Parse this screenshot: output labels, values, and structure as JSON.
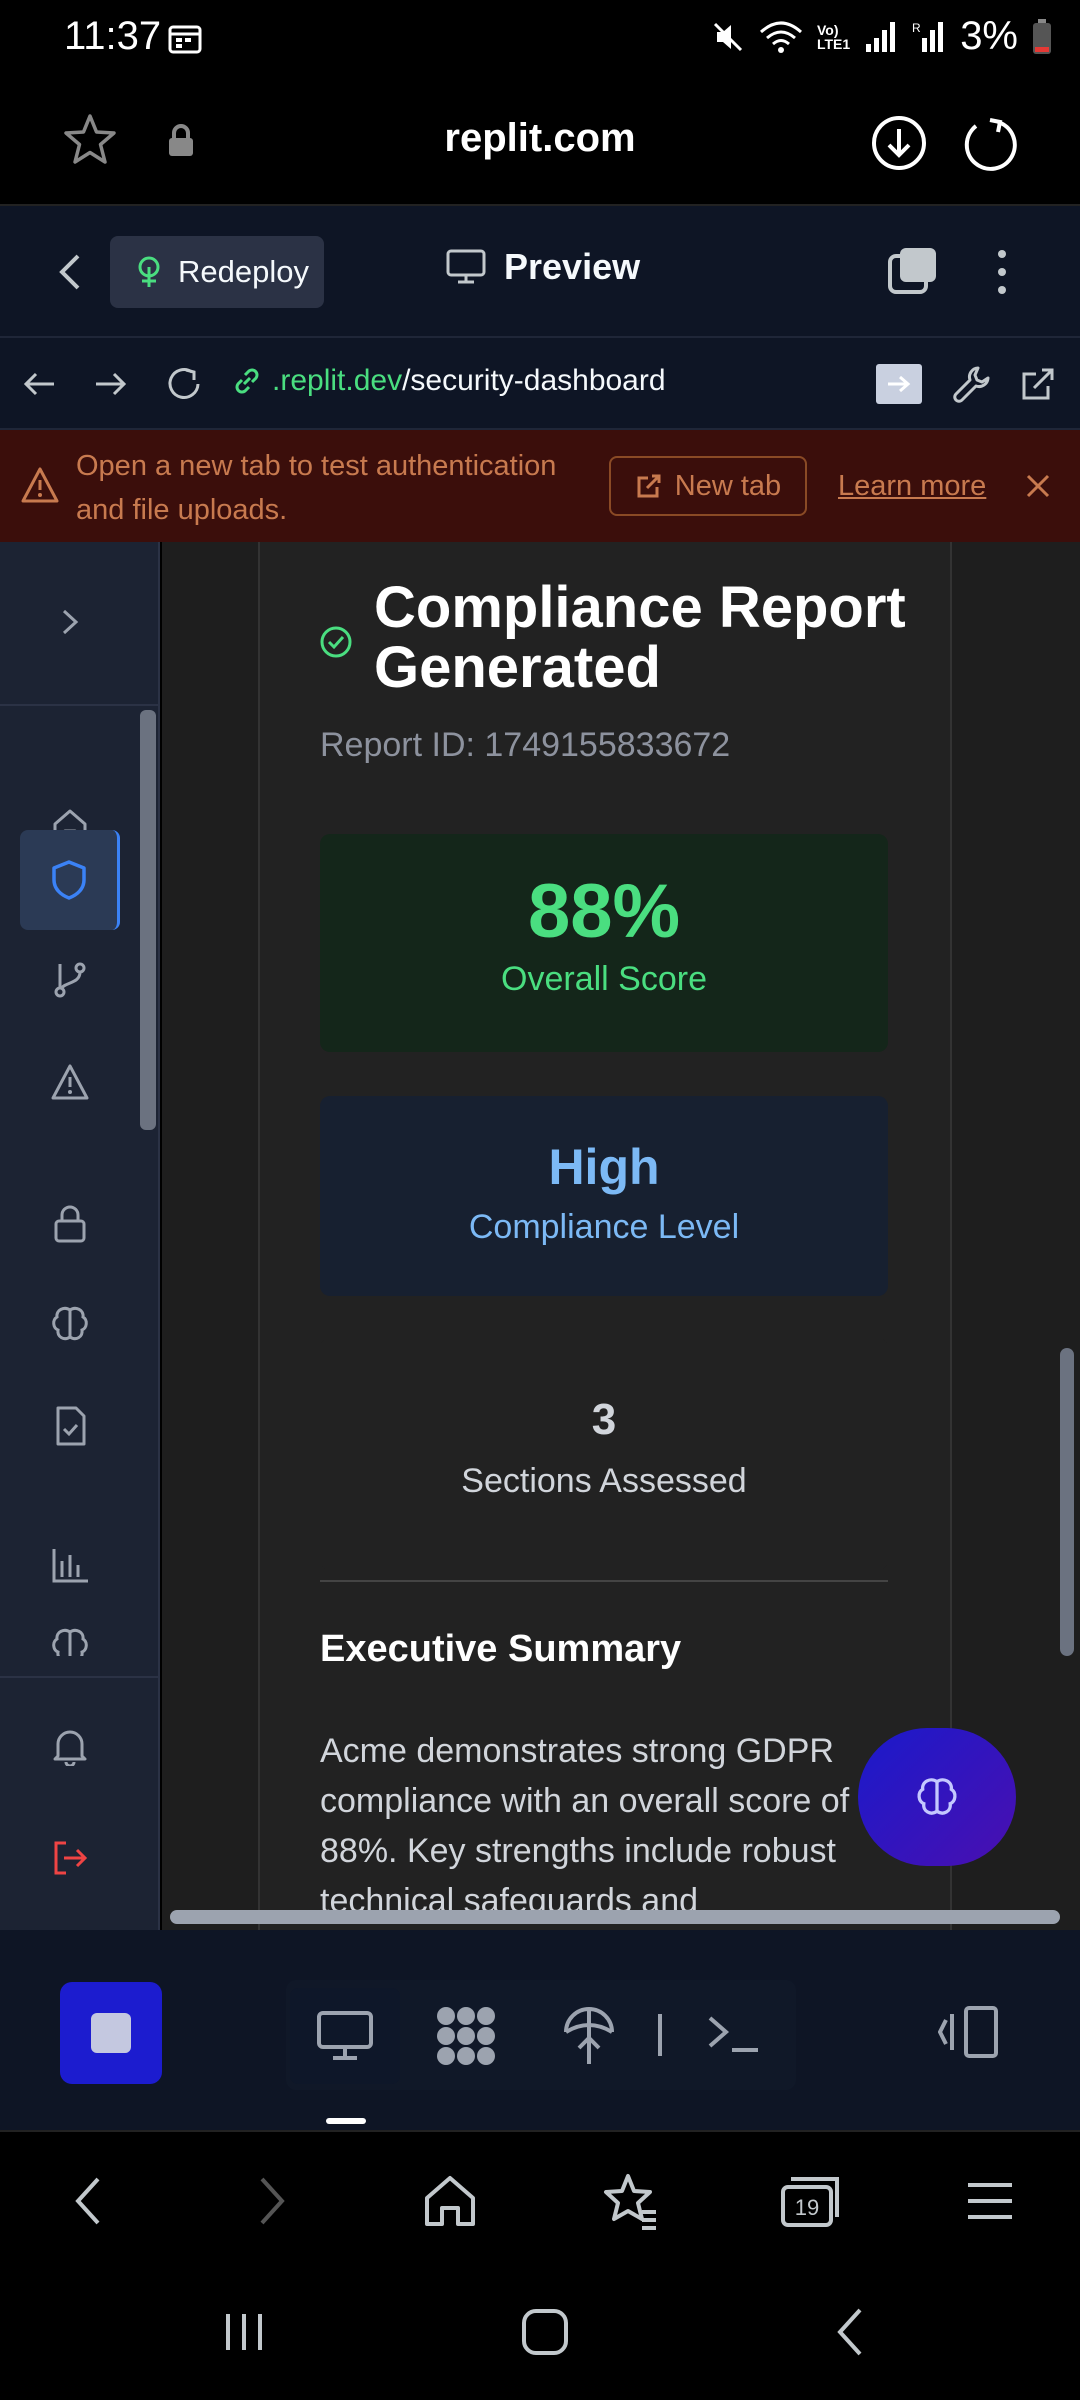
{
  "status_bar": {
    "time": "11:37",
    "battery": "3%"
  },
  "browser": {
    "url_title": "replit.com",
    "tab_count": "19"
  },
  "replit_header": {
    "redeploy_label": "Redeploy",
    "preview_label": "Preview"
  },
  "address_bar": {
    "domain": ".replit.dev",
    "path": "/security-dashboard"
  },
  "banner": {
    "message": "Open a new tab to test authentication and file uploads.",
    "new_tab_label": "New tab",
    "learn_more_label": "Learn more"
  },
  "sidebar": {
    "items": [
      "expand-icon",
      "home-icon",
      "shield-icon",
      "git-branch-icon",
      "warning-icon",
      "lock-icon",
      "brain-icon",
      "file-check-icon",
      "bar-chart-icon",
      "brain-icon",
      "bell-icon",
      "logout-icon"
    ],
    "active": "shield-icon"
  },
  "report": {
    "title": "Compliance Report Generated",
    "report_id": "Report ID: 1749155833672",
    "stats": [
      {
        "value": "88%",
        "label": "Overall Score",
        "color": "#4ade80"
      },
      {
        "value": "High",
        "label": "Compliance Level",
        "color": "#7cb9f5"
      },
      {
        "value": "3",
        "label": "Sections Assessed",
        "color": "#d1d5db"
      }
    ],
    "executive_summary_heading": "Executive Summary",
    "executive_summary_text": "Acme demonstrates strong GDPR compliance with an overall score of 88%. Key strengths include robust technical safeguards and"
  },
  "colors": {
    "accent": "#4ade80",
    "replit_bg": "#0e1525",
    "banner_bg": "#3b0e0b",
    "fab": "#2a15c6"
  }
}
